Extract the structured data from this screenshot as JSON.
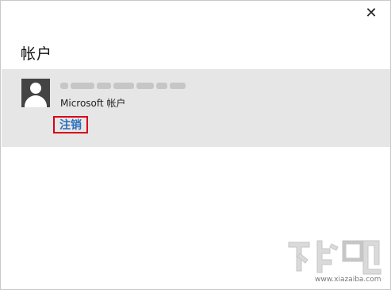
{
  "dialog": {
    "close_glyph": "✕",
    "title": "帐户"
  },
  "account": {
    "type_label": "Microsoft 帐户",
    "signout_label": "注销"
  },
  "watermark": {
    "logo_text": "下载吧",
    "site_text": "www.xiazaiba.com"
  },
  "colors": {
    "panel_bg": "#e6e6e6",
    "link": "#2a6ebb",
    "highlight_border": "#d9001b"
  }
}
